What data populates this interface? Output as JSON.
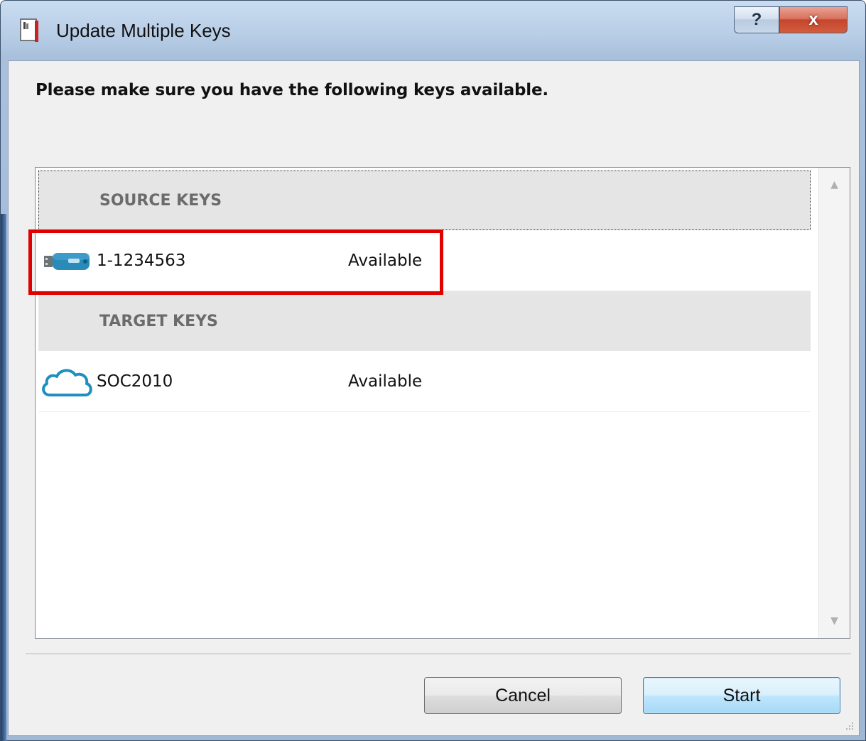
{
  "window": {
    "title": "Update Multiple Keys",
    "help_label": "?",
    "close_label": "x"
  },
  "heading": "Please make sure you have the following keys available.",
  "groups": [
    {
      "header": "SOURCE KEYS",
      "items": [
        {
          "icon": "usb-key-icon",
          "name": "1-1234563",
          "status": "Available"
        }
      ]
    },
    {
      "header": "TARGET KEYS",
      "items": [
        {
          "icon": "cloud-icon",
          "name": "SOC2010",
          "status": "Available"
        }
      ]
    }
  ],
  "buttons": {
    "cancel": "Cancel",
    "start": "Start"
  },
  "colors": {
    "highlight": "#e00000",
    "usb_icon": "#2a8ab8",
    "cloud_icon": "#1f8fbf",
    "group_header_bg": "#e5e5e5"
  }
}
